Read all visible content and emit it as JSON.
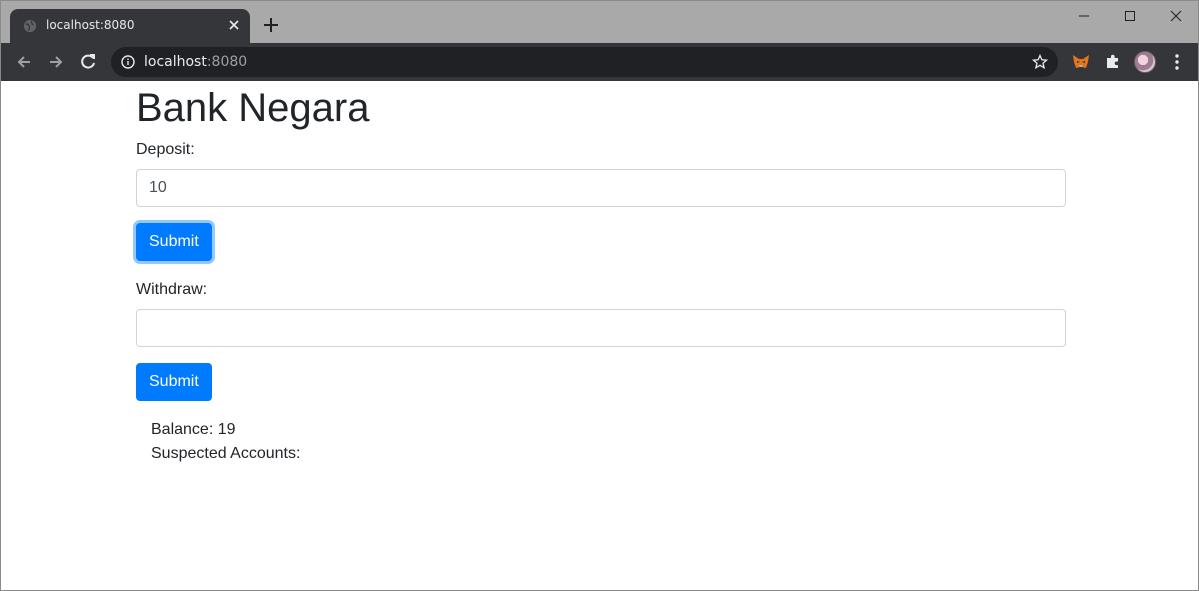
{
  "browser": {
    "tab_title": "localhost:8080",
    "url_host": "localhost",
    "url_port": ":8080",
    "icons": [
      "globe-icon",
      "close-icon",
      "plus-icon",
      "minimize-icon",
      "maximize-icon",
      "window-close-icon",
      "back-icon",
      "forward-icon",
      "reload-icon",
      "info-icon",
      "star-icon",
      "metamask-extension-icon",
      "puzzle-icon",
      "profile-avatar",
      "more-vert-icon"
    ]
  },
  "page": {
    "title": "Bank Negara",
    "deposit": {
      "label": "Deposit:",
      "value": "10",
      "submit_label": "Submit"
    },
    "withdraw": {
      "label": "Withdraw:",
      "value": "",
      "submit_label": "Submit"
    },
    "balance_text": "Balance: 19",
    "suspected_accounts_text": "Suspected Accounts:"
  },
  "colors": {
    "primary": "#007bff",
    "text": "#212529",
    "input_border": "#ced4da",
    "chrome_dark": "#35363a",
    "titlebar": "#a9a9a9"
  }
}
